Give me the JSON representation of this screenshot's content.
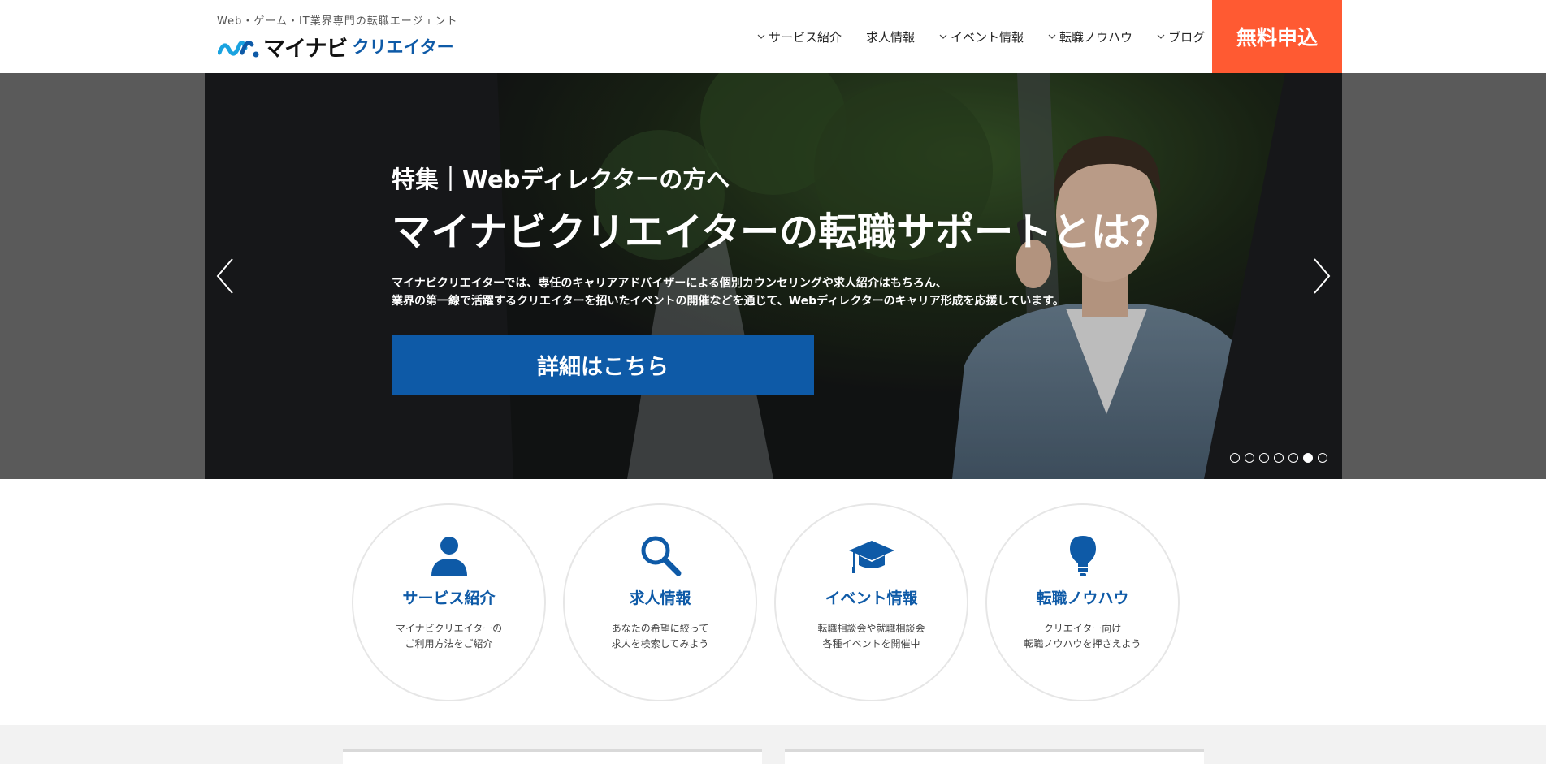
{
  "header": {
    "tagline": "Web・ゲーム・IT業界専門の転職エージェント",
    "logo_main": "マイナビ",
    "logo_sub": "クリエイター",
    "nav": [
      {
        "label": "サービス紹介",
        "has_dropdown": true
      },
      {
        "label": "求人情報",
        "has_dropdown": false
      },
      {
        "label": "イベント情報",
        "has_dropdown": true
      },
      {
        "label": "転職ノウハウ",
        "has_dropdown": true
      },
      {
        "label": "ブログ",
        "has_dropdown": true
      }
    ],
    "apply_label": "無料申込"
  },
  "hero": {
    "subtitle": "特集｜Webディレクターの方へ",
    "title": "マイナビクリエイターの転職サポートとは？",
    "desc_line1": "マイナビクリエイターでは、専任のキャリアアドバイザーによる個別カウンセリングや求人紹介はもちろん、",
    "desc_line2": "業界の第一線で活躍するクリエイターを招いたイベントの開催などを通じて、Webディレクターのキャリア形成を応援しています。",
    "cta_label": "詳細はこちら",
    "slide_count": 7,
    "active_slide": 6
  },
  "features": [
    {
      "icon": "person-icon",
      "title": "サービス紹介",
      "desc": "マイナビクリエイターの\nご利用方法をご紹介"
    },
    {
      "icon": "search-icon",
      "title": "求人情報",
      "desc": "あなたの希望に絞って\n求人を検索してみよう"
    },
    {
      "icon": "graduation-cap-icon",
      "title": "イベント情報",
      "desc": "転職相談会や就職相談会\n各種イベントを開催中"
    },
    {
      "icon": "lightbulb-icon",
      "title": "転職ノウハウ",
      "desc": "クリエイター向け\n転職ノウハウを押さえよう"
    }
  ],
  "colors": {
    "brand_blue": "#0e5aa7",
    "accent_orange": "#ff5a32",
    "logo_cyan": "#1aa3e0"
  }
}
